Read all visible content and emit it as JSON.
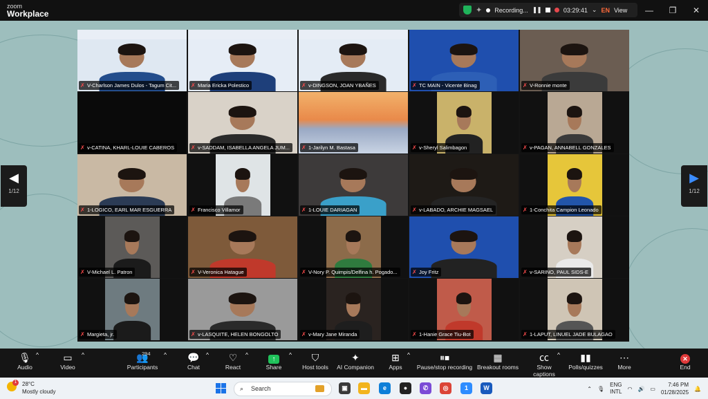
{
  "app": {
    "brand_small": "zoom",
    "brand_title": "Workplace",
    "recording_label": "Recording...",
    "timer": "03:29:41",
    "language": "EN",
    "view_label": "View"
  },
  "pager": {
    "left_label": "1/12",
    "right_label": "1/12"
  },
  "participants": [
    {
      "name": "V-Charlson James Dulos - Tagum Cit..."
    },
    {
      "name": "Maria Ericka Polestico"
    },
    {
      "name": "v-DINGSON, JOAN YBAÑES"
    },
    {
      "name": "TC MAIN - Vicente Binag"
    },
    {
      "name": "V-Ronnie monte"
    },
    {
      "name": "v-CATINA, KHARL-LOUIE CABEROS"
    },
    {
      "name": "v-SADDAM, ISABELLA ANGELA JUM..."
    },
    {
      "name": "1-Jarilyn M. Bastasa"
    },
    {
      "name": "v-Sheryl Salimbagon"
    },
    {
      "name": "v-PAGAN, ANNABELL GONZALES"
    },
    {
      "name": "1-LOGICO, EARL MAR ESGUERRA"
    },
    {
      "name": "Francisco Villamor"
    },
    {
      "name": "1-LOUIE DARIAGAN"
    },
    {
      "name": "v-LABADO, ARCHIE MAGSAEL"
    },
    {
      "name": "1-Conchita Campion Leonado"
    },
    {
      "name": "V-Michael L. Patron"
    },
    {
      "name": "V-Veronica Hatague"
    },
    {
      "name": "V-Nory P. Quimpis/Delfina h. Pogado..."
    },
    {
      "name": "Joy Fritz"
    },
    {
      "name": "v-SARINO, PAUL SIDS-E"
    },
    {
      "name": "Margieta, jr."
    },
    {
      "name": "v-LASQUITE, HELEN BONGOLTO"
    },
    {
      "name": "v-Mary Jane Miranda"
    },
    {
      "name": "1-Hanie Grace Tiu-Bot"
    },
    {
      "name": "1-LAPUT, LINUEL JADE BULAGAO"
    }
  ],
  "toolbar": {
    "audio": "Audio",
    "video": "Video",
    "participants": "Participants",
    "participants_count": "294",
    "chat": "Chat",
    "react": "React",
    "share": "Share",
    "host_tools": "Host tools",
    "ai_companion": "AI Companion",
    "apps": "Apps",
    "pause_stop": "Pause/stop recording",
    "breakout": "Breakout rooms",
    "captions": "Show captions",
    "polls": "Polls/quizzes",
    "more": "More",
    "end": "End"
  },
  "taskbar": {
    "weather_temp": "28°C",
    "weather_desc": "Mostly cloudy",
    "weather_badge": "1",
    "search_placeholder": "Search",
    "lang_line1": "ENG",
    "lang_line2": "INTL",
    "time": "7:46 PM",
    "date": "01/28/2025",
    "zoom_badge": "1"
  },
  "colors": {
    "stage_bg": "#9dbebd",
    "active_speaker": "#2dd46b",
    "end_red": "#e03a3a",
    "share_green": "#20c25b"
  }
}
